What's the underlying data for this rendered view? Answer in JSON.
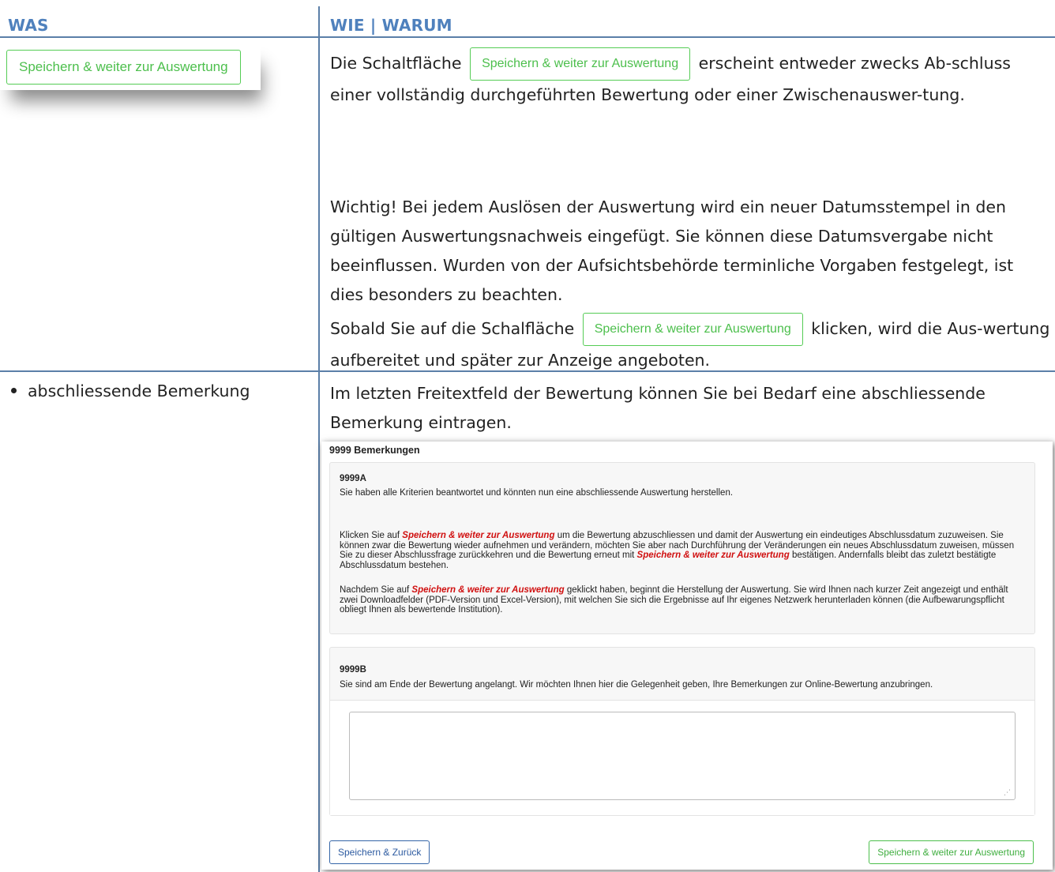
{
  "header": {
    "col1": "WAS",
    "col2": "WIE | WARUM"
  },
  "row1": {
    "button_image_label": "Speichern & weiter zur Auswertung",
    "p1_before": "Die Schaltfläche",
    "p1_button": "Speichern & weiter zur Auswertung",
    "p1_after": "erscheint entweder zwecks Ab-schluss einer vollständig durchgeführten Bewertung oder einer Zwischenauswer-tung.",
    "p2": "Wichtig! Bei jedem Auslösen der Auswertung wird ein neuer Datumsstempel in den gültigen Auswertungsnachweis eingefügt. Sie können diese Datumsvergabe nicht beeinflussen. Wurden von der Aufsichtsbehörde terminliche Vorgaben festgelegt, ist dies besonders zu beachten.",
    "p3_before": "Sobald Sie auf die Schalfläche",
    "p3_button": "Speichern & weiter zur Auswertung",
    "p3_after": "klicken, wird die Aus-wertung aufbereitet und später zur Anzeige angeboten."
  },
  "row2": {
    "bullet": "abschliessende Bemerkung",
    "text": "Im letzten Freitextfeld der Bewertung können Sie bei Bedarf eine abschliessende Bemerkung eintragen."
  },
  "screenshot": {
    "title": "9999 Bemerkungen",
    "qA": {
      "id": "9999A",
      "line1": "Sie haben alle Kriterien beantwortet und könnten nun eine abschliessende Auswertung herstellen.",
      "p2_a": "Klicken Sie auf",
      "p2_red1": "Speichern & weiter zur Auswertung",
      "p2_b": "um die Bewertung abzuschliessen und damit der Auswertung ein eindeutiges Abschlussdatum zuzuweisen. Sie können zwar die Bewertung wieder aufnehmen und verändern, möchten Sie aber nach Durchführung der Veränderungen ein neues Abschlussdatum zuweisen, müssen Sie zu dieser Abschlussfrage zurückkehren und die Bewertung erneut mit",
      "p2_red2": "Speichern & weiter zur Auswertung",
      "p2_c": "bestätigen. Andernfalls bleibt das zuletzt bestätigte Abschlussdatum bestehen.",
      "p3_a": "Nachdem Sie auf",
      "p3_red": "Speichern & weiter zur Auswertung",
      "p3_b": "geklickt haben, beginnt die Herstellung der Auswertung. Sie wird Ihnen nach kurzer Zeit angezeigt und enthält zwei Downloadfelder (PDF-Version und Excel-Version), mit welchen Sie sich die Ergebnisse auf Ihr eigenes Netzwerk herunterladen können (die Aufbewarungspflicht obliegt Ihnen als bewertende Institution)."
    },
    "qB": {
      "id": "9999B",
      "line1": "Sie sind am Ende der Bewertung angelangt. Wir möchten Ihnen hier die Gelegenheit geben, Ihre Bemerkungen zur Online-Bewertung anzubringen.",
      "textarea_value": ""
    },
    "back_button": "Speichern & Zurück",
    "next_button": "Speichern & weiter zur Auswertung"
  }
}
